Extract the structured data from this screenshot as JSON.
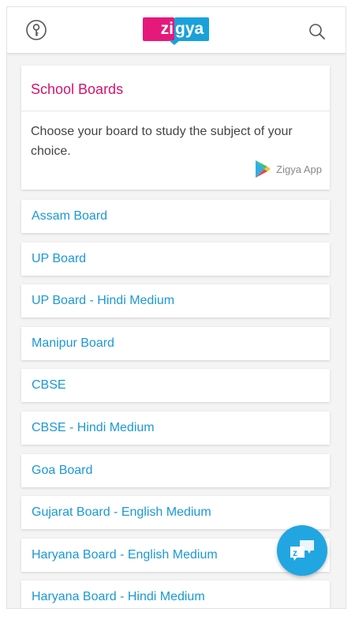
{
  "header": {
    "logo_left": "zi",
    "logo_right": "gya",
    "key_icon": "key-icon",
    "search_icon": "search-icon"
  },
  "intro_card": {
    "title": "School Boards",
    "description": "Choose your board to study the subject of your choice.",
    "app_link": {
      "label": "Zigya App",
      "icon": "play-store-icon"
    }
  },
  "boards": [
    {
      "label": "Assam Board"
    },
    {
      "label": "UP Board"
    },
    {
      "label": "UP Board - Hindi Medium"
    },
    {
      "label": "Manipur Board"
    },
    {
      "label": "CBSE"
    },
    {
      "label": "CBSE - Hindi Medium"
    },
    {
      "label": "Goa Board"
    },
    {
      "label": "Gujarat Board - English Medium"
    },
    {
      "label": "Haryana Board - English Medium"
    },
    {
      "label": "Haryana Board - Hindi Medium"
    }
  ],
  "fab": {
    "icon": "zigya-chat-icon"
  },
  "colors": {
    "accent_pink": "#e6197a",
    "accent_blue": "#1aa1dc",
    "link_blue": "#1a98d6",
    "title_pink": "#d3146e",
    "background": "#f4f4f4"
  }
}
